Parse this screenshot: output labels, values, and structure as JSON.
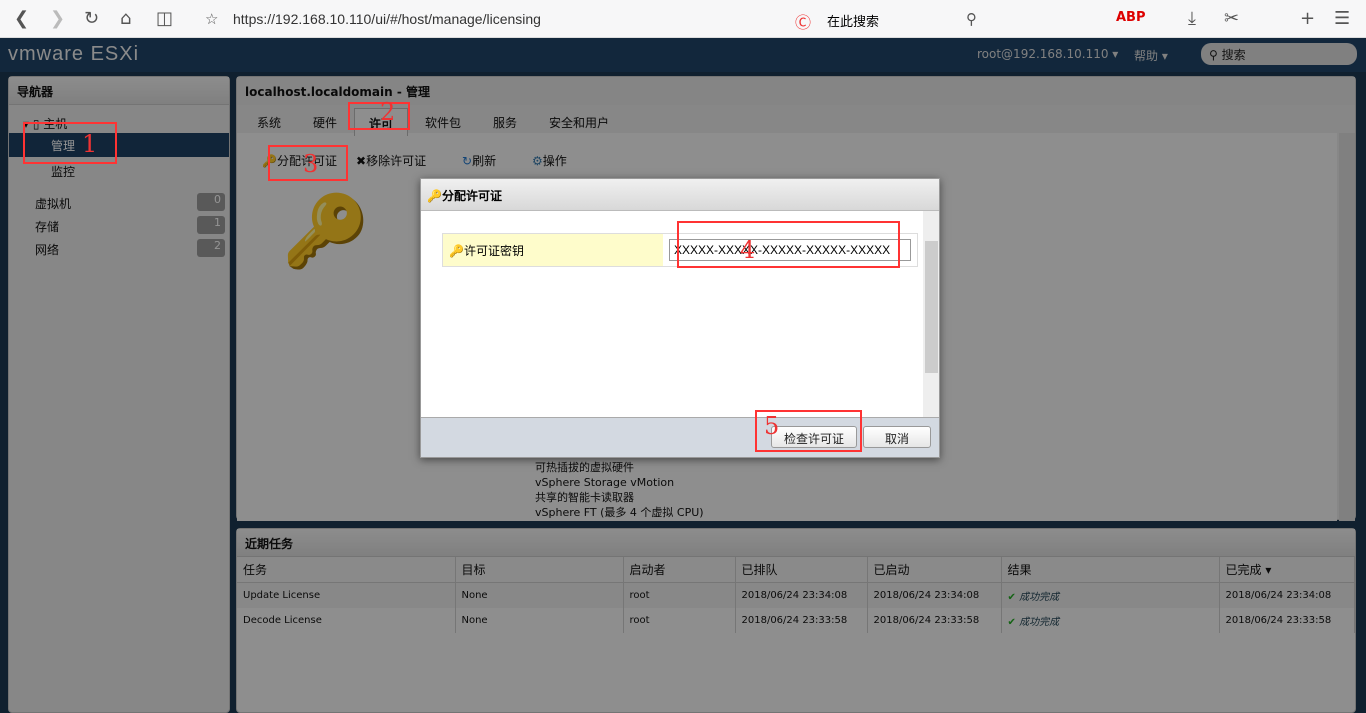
{
  "browser": {
    "url": "https://192.168.10.110/ui/#/host/manage/licensing",
    "search_placeholder": "在此搜索"
  },
  "header": {
    "logo": "vmware ESXi",
    "user": "root@192.168.10.110 ▾",
    "help": "帮助 ▾",
    "search_placeholder": "搜索"
  },
  "navigator": {
    "title": "导航器",
    "host": "主机",
    "items": [
      {
        "label": "管理"
      },
      {
        "label": "监控"
      }
    ],
    "groups": [
      {
        "label": "虚拟机",
        "count": "0"
      },
      {
        "label": "存储",
        "count": "1"
      },
      {
        "label": "网络",
        "count": "2"
      }
    ]
  },
  "main": {
    "title": "localhost.localdomain - 管理",
    "tabs": [
      "系统",
      "硬件",
      "许可",
      "软件包",
      "服务",
      "安全和用户"
    ],
    "toolbar": {
      "assign": "分配许可证",
      "remove": "移除许可证",
      "refresh": "刷新",
      "actions": "操作"
    },
    "features": [
      "可热插拔的虚拟硬件",
      "vSphere Storage vMotion",
      "共享的智能卡读取器",
      "vSphere FT (最多 4 个虚拟 CPU)"
    ]
  },
  "tasks": {
    "title": "近期任务",
    "columns": [
      "任务",
      "目标",
      "启动者",
      "已排队",
      "已启动",
      "结果",
      "已完成 ▾"
    ],
    "rows": [
      [
        "Update License",
        "None",
        "root",
        "2018/06/24 23:34:08",
        "2018/06/24 23:34:08",
        "成功完成",
        "2018/06/24 23:34:08"
      ],
      [
        "Decode License",
        "None",
        "root",
        "2018/06/24 23:33:58",
        "2018/06/24 23:33:58",
        "成功完成",
        "2018/06/24 23:33:58"
      ]
    ]
  },
  "dialog": {
    "title": "分配许可证",
    "field_label": "许可证密钥",
    "field_value": "XXXXX-XXXXX-XXXXX-XXXXX-XXXXX",
    "check": "检查许可证",
    "cancel": "取消"
  },
  "annotations": [
    "1",
    "2",
    "3",
    "4",
    "5"
  ],
  "colors": {
    "annotation": "#ff3333",
    "header": "#1f4468"
  }
}
